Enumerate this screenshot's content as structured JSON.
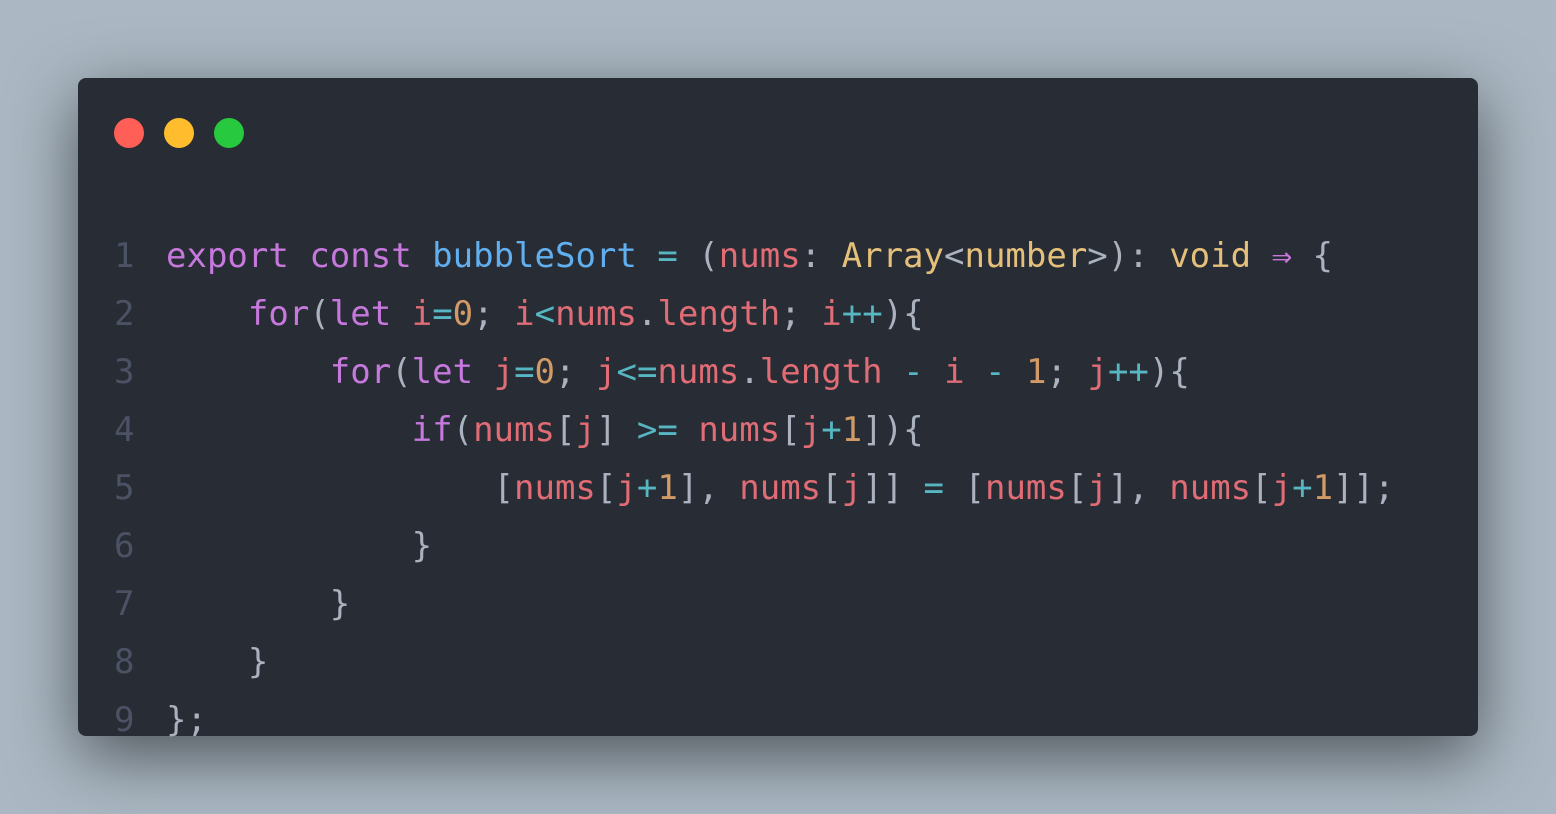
{
  "colors": {
    "background": "#abb8c3",
    "window": "#282c34",
    "dot_red": "#ff5f56",
    "dot_yellow": "#ffbd2e",
    "dot_green": "#27c93f",
    "line_number": "#4b5263",
    "keyword": "#c678dd",
    "function": "#61afef",
    "variable": "#e06c75",
    "type": "#e5c07b",
    "number": "#d19a66",
    "operator": "#56b6c2",
    "punctuation": "#abb2bf"
  },
  "window_controls": [
    {
      "name": "close-dot",
      "color_key": "dot_red"
    },
    {
      "name": "minimize-dot",
      "color_key": "dot_yellow"
    },
    {
      "name": "maximize-dot",
      "color_key": "dot_green"
    }
  ],
  "code_lines": [
    {
      "number": "1",
      "tokens": [
        {
          "t": "export",
          "c": "keyword"
        },
        {
          "t": " ",
          "c": "punctuation"
        },
        {
          "t": "const",
          "c": "keyword"
        },
        {
          "t": " ",
          "c": "punctuation"
        },
        {
          "t": "bubbleSort",
          "c": "function"
        },
        {
          "t": " ",
          "c": "punctuation"
        },
        {
          "t": "=",
          "c": "operator"
        },
        {
          "t": " (",
          "c": "punctuation"
        },
        {
          "t": "nums",
          "c": "variable"
        },
        {
          "t": ": ",
          "c": "punctuation"
        },
        {
          "t": "Array",
          "c": "type"
        },
        {
          "t": "<",
          "c": "punctuation"
        },
        {
          "t": "number",
          "c": "type"
        },
        {
          "t": ">): ",
          "c": "punctuation"
        },
        {
          "t": "void",
          "c": "type"
        },
        {
          "t": " ",
          "c": "punctuation"
        },
        {
          "t": "⇒",
          "c": "keyword"
        },
        {
          "t": " {",
          "c": "punctuation"
        }
      ]
    },
    {
      "number": "2",
      "tokens": [
        {
          "t": "    ",
          "c": "punctuation"
        },
        {
          "t": "for",
          "c": "keyword"
        },
        {
          "t": "(",
          "c": "punctuation"
        },
        {
          "t": "let",
          "c": "keyword"
        },
        {
          "t": " ",
          "c": "punctuation"
        },
        {
          "t": "i",
          "c": "variable"
        },
        {
          "t": "=",
          "c": "operator"
        },
        {
          "t": "0",
          "c": "number"
        },
        {
          "t": "; ",
          "c": "punctuation"
        },
        {
          "t": "i",
          "c": "variable"
        },
        {
          "t": "<",
          "c": "operator"
        },
        {
          "t": "nums",
          "c": "variable"
        },
        {
          "t": ".",
          "c": "punctuation"
        },
        {
          "t": "length",
          "c": "variable"
        },
        {
          "t": "; ",
          "c": "punctuation"
        },
        {
          "t": "i",
          "c": "variable"
        },
        {
          "t": "++",
          "c": "operator"
        },
        {
          "t": "){",
          "c": "punctuation"
        }
      ]
    },
    {
      "number": "3",
      "tokens": [
        {
          "t": "        ",
          "c": "punctuation"
        },
        {
          "t": "for",
          "c": "keyword"
        },
        {
          "t": "(",
          "c": "punctuation"
        },
        {
          "t": "let",
          "c": "keyword"
        },
        {
          "t": " ",
          "c": "punctuation"
        },
        {
          "t": "j",
          "c": "variable"
        },
        {
          "t": "=",
          "c": "operator"
        },
        {
          "t": "0",
          "c": "number"
        },
        {
          "t": "; ",
          "c": "punctuation"
        },
        {
          "t": "j",
          "c": "variable"
        },
        {
          "t": "<=",
          "c": "operator"
        },
        {
          "t": "nums",
          "c": "variable"
        },
        {
          "t": ".",
          "c": "punctuation"
        },
        {
          "t": "length",
          "c": "variable"
        },
        {
          "t": " ",
          "c": "punctuation"
        },
        {
          "t": "-",
          "c": "operator"
        },
        {
          "t": " ",
          "c": "punctuation"
        },
        {
          "t": "i",
          "c": "variable"
        },
        {
          "t": " ",
          "c": "punctuation"
        },
        {
          "t": "-",
          "c": "operator"
        },
        {
          "t": " ",
          "c": "punctuation"
        },
        {
          "t": "1",
          "c": "number"
        },
        {
          "t": "; ",
          "c": "punctuation"
        },
        {
          "t": "j",
          "c": "variable"
        },
        {
          "t": "++",
          "c": "operator"
        },
        {
          "t": "){",
          "c": "punctuation"
        }
      ]
    },
    {
      "number": "4",
      "tokens": [
        {
          "t": "            ",
          "c": "punctuation"
        },
        {
          "t": "if",
          "c": "keyword"
        },
        {
          "t": "(",
          "c": "punctuation"
        },
        {
          "t": "nums",
          "c": "variable"
        },
        {
          "t": "[",
          "c": "punctuation"
        },
        {
          "t": "j",
          "c": "variable"
        },
        {
          "t": "] ",
          "c": "punctuation"
        },
        {
          "t": ">=",
          "c": "operator"
        },
        {
          "t": " ",
          "c": "punctuation"
        },
        {
          "t": "nums",
          "c": "variable"
        },
        {
          "t": "[",
          "c": "punctuation"
        },
        {
          "t": "j",
          "c": "variable"
        },
        {
          "t": "+",
          "c": "operator"
        },
        {
          "t": "1",
          "c": "number"
        },
        {
          "t": "]){",
          "c": "punctuation"
        }
      ]
    },
    {
      "number": "5",
      "tokens": [
        {
          "t": "                ",
          "c": "punctuation"
        },
        {
          "t": "[",
          "c": "punctuation"
        },
        {
          "t": "nums",
          "c": "variable"
        },
        {
          "t": "[",
          "c": "punctuation"
        },
        {
          "t": "j",
          "c": "variable"
        },
        {
          "t": "+",
          "c": "operator"
        },
        {
          "t": "1",
          "c": "number"
        },
        {
          "t": "], ",
          "c": "punctuation"
        },
        {
          "t": "nums",
          "c": "variable"
        },
        {
          "t": "[",
          "c": "punctuation"
        },
        {
          "t": "j",
          "c": "variable"
        },
        {
          "t": "]] ",
          "c": "punctuation"
        },
        {
          "t": "=",
          "c": "operator"
        },
        {
          "t": " [",
          "c": "punctuation"
        },
        {
          "t": "nums",
          "c": "variable"
        },
        {
          "t": "[",
          "c": "punctuation"
        },
        {
          "t": "j",
          "c": "variable"
        },
        {
          "t": "], ",
          "c": "punctuation"
        },
        {
          "t": "nums",
          "c": "variable"
        },
        {
          "t": "[",
          "c": "punctuation"
        },
        {
          "t": "j",
          "c": "variable"
        },
        {
          "t": "+",
          "c": "operator"
        },
        {
          "t": "1",
          "c": "number"
        },
        {
          "t": "]];",
          "c": "punctuation"
        }
      ]
    },
    {
      "number": "6",
      "tokens": [
        {
          "t": "            ",
          "c": "punctuation"
        },
        {
          "t": "}",
          "c": "punctuation"
        }
      ]
    },
    {
      "number": "7",
      "tokens": [
        {
          "t": "        ",
          "c": "punctuation"
        },
        {
          "t": "}",
          "c": "punctuation"
        }
      ]
    },
    {
      "number": "8",
      "tokens": [
        {
          "t": "    ",
          "c": "punctuation"
        },
        {
          "t": "}",
          "c": "punctuation"
        }
      ]
    },
    {
      "number": "9",
      "tokens": [
        {
          "t": "};",
          "c": "punctuation"
        }
      ]
    }
  ]
}
